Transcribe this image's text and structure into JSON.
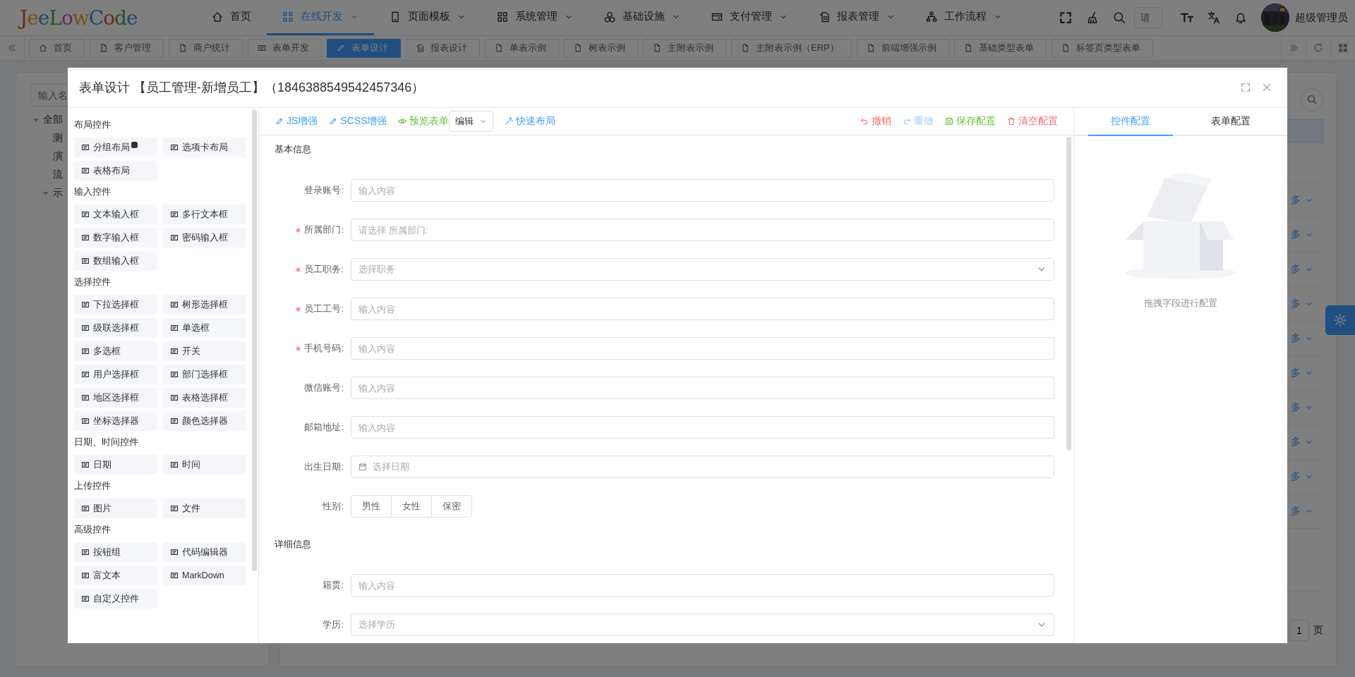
{
  "header": {
    "logo": "JeeLowCode",
    "nav": [
      {
        "label": "首页",
        "dropdown": false,
        "selected": false
      },
      {
        "label": "在线开发",
        "dropdown": true,
        "selected": true
      },
      {
        "label": "页面模板",
        "dropdown": true,
        "selected": false
      },
      {
        "label": "系统管理",
        "dropdown": true,
        "selected": false
      },
      {
        "label": "基础设施",
        "dropdown": true,
        "selected": false
      },
      {
        "label": "支付管理",
        "dropdown": true,
        "selected": false
      },
      {
        "label": "报表管理",
        "dropdown": true,
        "selected": false
      },
      {
        "label": "工作流程",
        "dropdown": true,
        "selected": false
      }
    ],
    "search": {
      "placeholder": "请"
    },
    "user": "超级管理员"
  },
  "tabs": [
    {
      "label": "首页",
      "selected": false
    },
    {
      "label": "客户管理",
      "selected": false
    },
    {
      "label": "商户统计",
      "selected": false
    },
    {
      "label": "表单开发",
      "selected": false
    },
    {
      "label": "表单设计",
      "selected": true
    },
    {
      "label": "报表设计",
      "selected": false
    },
    {
      "label": "单表示例",
      "selected": false
    },
    {
      "label": "树表示例",
      "selected": false
    },
    {
      "label": "主附表示例",
      "selected": false
    },
    {
      "label": "主附表示例（ERP）",
      "selected": false
    },
    {
      "label": "前端增强示例",
      "selected": false
    },
    {
      "label": "基础类型表单",
      "selected": false
    },
    {
      "label": "标签页类型表单",
      "selected": false
    }
  ],
  "sidebar": {
    "search": {
      "placeholder": "输入名"
    },
    "tree": [
      {
        "label": "全部",
        "expanded": true,
        "children": [
          {
            "label": "测"
          },
          {
            "label": "演"
          },
          {
            "label": "流"
          },
          {
            "label": "示",
            "expanded": true
          }
        ]
      }
    ]
  },
  "list": {
    "row_actions": [
      "多",
      "多",
      "多",
      "多",
      "多",
      "多",
      "多",
      "多",
      "多",
      "多"
    ],
    "pagination": {
      "page": "1",
      "unit": "页"
    }
  },
  "dialog": {
    "title": "表单设计 【员工管理-新增员工】（1846388549542457346）",
    "palette": [
      {
        "title": "布局控件",
        "items": [
          {
            "label": "分组布局",
            "info": true
          },
          {
            "label": "选项卡布局"
          },
          {
            "label": "表格布局"
          }
        ]
      },
      {
        "title": "输入控件",
        "items": [
          {
            "label": "文本输入框"
          },
          {
            "label": "多行文本框"
          },
          {
            "label": "数字输入框"
          },
          {
            "label": "密码输入框"
          },
          {
            "label": "数组输入框"
          }
        ]
      },
      {
        "title": "选择控件",
        "items": [
          {
            "label": "下拉选择框"
          },
          {
            "label": "树形选择框"
          },
          {
            "label": "级联选择框"
          },
          {
            "label": "单选框"
          },
          {
            "label": "多选框"
          },
          {
            "label": "开关"
          },
          {
            "label": "用户选择框"
          },
          {
            "label": "部门选择框"
          },
          {
            "label": "地区选择框"
          },
          {
            "label": "表格选择框"
          },
          {
            "label": "坐标选择器"
          },
          {
            "label": "颜色选择器"
          }
        ]
      },
      {
        "title": "日期、时间控件",
        "items": [
          {
            "label": "日期"
          },
          {
            "label": "时间"
          }
        ]
      },
      {
        "title": "上传控件",
        "items": [
          {
            "label": "图片"
          },
          {
            "label": "文件"
          }
        ]
      },
      {
        "title": "高级控件",
        "items": [
          {
            "label": "按钮组"
          },
          {
            "label": "代码编辑器"
          },
          {
            "label": "富文本"
          },
          {
            "label": "MarkDown"
          },
          {
            "label": "自定义控件"
          }
        ]
      }
    ],
    "toolbar": {
      "left": [
        {
          "kind": "primary",
          "label": "JS增强"
        },
        {
          "kind": "primary",
          "label": "SCSS增强"
        },
        {
          "kind": "success",
          "label": "预览表单"
        },
        {
          "kind": "select",
          "value": "编辑"
        },
        {
          "kind": "primary",
          "label": "快速布局"
        }
      ],
      "right": [
        {
          "kind": "danger",
          "label": "撤销",
          "disabled": false
        },
        {
          "kind": "primary",
          "label": "重做",
          "disabled": true
        },
        {
          "kind": "success",
          "label": "保存配置",
          "disabled": false
        },
        {
          "kind": "danger",
          "label": "清空配置",
          "disabled": false
        }
      ]
    },
    "form": [
      {
        "title": "基本信息",
        "fields": [
          {
            "kind": "input",
            "label": "登录账号:",
            "required": false,
            "placeholder": "输入内容"
          },
          {
            "kind": "input",
            "label": "所属部门:",
            "required": true,
            "placeholder": "请选择 所属部门:"
          },
          {
            "kind": "select",
            "label": "员工职务:",
            "required": true,
            "placeholder": "选择职务"
          },
          {
            "kind": "input",
            "label": "员工工号:",
            "required": true,
            "placeholder": "输入内容"
          },
          {
            "kind": "input",
            "label": "手机号码:",
            "required": true,
            "placeholder": "输入内容"
          },
          {
            "kind": "input",
            "label": "微信账号:",
            "required": false,
            "placeholder": "输入内容"
          },
          {
            "kind": "input",
            "label": "邮箱地址:",
            "required": false,
            "placeholder": "输入内容"
          },
          {
            "kind": "date",
            "label": "出生日期:",
            "required": false,
            "placeholder": "选择日期"
          },
          {
            "kind": "radio",
            "label": "性别:",
            "required": false,
            "options": [
              {
                "label": "男性",
                "selected": false
              },
              {
                "label": "女性",
                "selected": false
              },
              {
                "label": "保密",
                "selected": false
              }
            ]
          }
        ]
      },
      {
        "title": "详细信息",
        "fields": [
          {
            "kind": "input",
            "label": "籍贯:",
            "required": false,
            "placeholder": "输入内容"
          },
          {
            "kind": "select",
            "label": "学历:",
            "required": false,
            "placeholder": "选择学历"
          }
        ]
      }
    ],
    "settings": {
      "tabs": [
        {
          "label": "控件配置",
          "selected": true
        },
        {
          "label": "表单配置",
          "selected": false
        }
      ],
      "empty_text": "拖拽字段进行配置"
    }
  }
}
